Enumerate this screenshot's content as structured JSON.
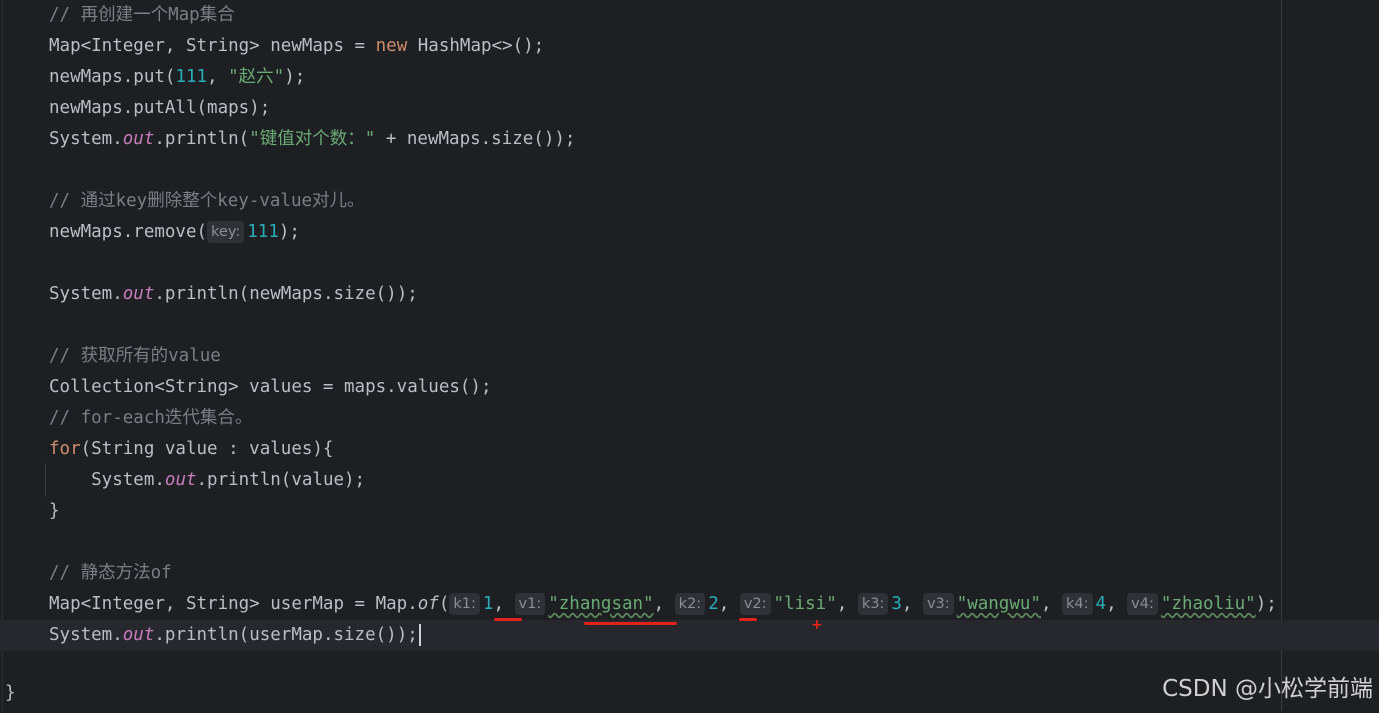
{
  "editor": {
    "lines": {
      "l1_comment": "// 再创建一个Map集合",
      "l2": {
        "a": "Map<Integer, String> newMaps = ",
        "kw": "new",
        "b": " HashMap<>();"
      },
      "l3": {
        "a": "newMaps.put(",
        "num": "111",
        "b": ", ",
        "str": "\"赵六\"",
        "c": ");"
      },
      "l4": "newMaps.putAll(maps);",
      "l5": {
        "a": "System.",
        "out": "out",
        "b": ".println(",
        "str": "\"键值对个数：\"",
        "c": " + newMaps.size());"
      },
      "l6_comment": "// 通过key删除整个key-value对儿。",
      "l7": {
        "a": "newMaps.remove(",
        "hint": "key:",
        "num": "111",
        "b": ");"
      },
      "l8": {
        "a": "System.",
        "out": "out",
        "b": ".println(newMaps.size());"
      },
      "l9_comment": "// 获取所有的value",
      "l10": "Collection<String> values = maps.values();",
      "l11_comment": "// for-each迭代集合。",
      "l12": {
        "kw": "for",
        "b": "(String value : values){"
      },
      "l13": {
        "a": "    System.",
        "out": "out",
        "b": ".println(value);"
      },
      "l14": "}",
      "l15_comment": "// 静态方法of",
      "l16": {
        "a": "Map<Integer, String> userMap = Map.",
        "of": "of",
        "open": "(",
        "hk1": "k1:",
        "v_k1": "1",
        "s1": ", ",
        "hv1": "v1:",
        "v_v1": "\"zhangsan\"",
        "s2": ", ",
        "hk2": "k2:",
        "v_k2": "2",
        "s3": ", ",
        "hv2": "v2:",
        "v_v2": "\"lisi\"",
        "s4": ", ",
        "hk3": "k3:",
        "v_k3": "3",
        "s5": ", ",
        "hv3": "v3:",
        "v_v3": "\"wangwu\"",
        "s6": ", ",
        "hk4": "k4:",
        "v_k4": "4",
        "s7": ", ",
        "hv4": "v4:",
        "v_v4": "\"zhaoliu\"",
        "close": ");"
      },
      "l17": {
        "a": "System.",
        "out": "out",
        "b": ".println(userMap.size());"
      },
      "closing_brace": "}"
    }
  },
  "watermark": "CSDN @小松学前端",
  "colors": {
    "background": "#1e1f22",
    "keyword": "#cf8e6d",
    "number": "#2aacb8",
    "string": "#6aab73",
    "field": "#c77dbb",
    "comment": "#7a7e85",
    "annotation_mark": "#e2231a"
  }
}
